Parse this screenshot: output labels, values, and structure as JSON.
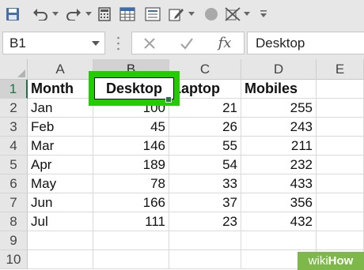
{
  "toolbar": {
    "icons": [
      "save-icon",
      "undo-icon",
      "redo-icon",
      "calculator-icon",
      "table-icon",
      "form-icon",
      "edit-icon",
      "circle-icon",
      "eraser-icon",
      "customize-icon"
    ]
  },
  "formula_bar": {
    "name_box": "B1",
    "function_label": "fx",
    "content": "Desktop"
  },
  "columns": [
    "A",
    "B",
    "C",
    "D",
    "E"
  ],
  "selected_column": "B",
  "rows": [
    "1",
    "2",
    "3",
    "4",
    "5",
    "6",
    "7",
    "8",
    "9",
    "10"
  ],
  "selected_row": "1",
  "headers": [
    "Month",
    "Desktop",
    "Laptop",
    "Mobiles"
  ],
  "data": [
    [
      "Jan",
      "100",
      "21",
      "255"
    ],
    [
      "Feb",
      "45",
      "26",
      "243"
    ],
    [
      "Mar",
      "146",
      "55",
      "211"
    ],
    [
      "Apr",
      "189",
      "54",
      "232"
    ],
    [
      "May",
      "78",
      "33",
      "433"
    ],
    [
      "Jun",
      "166",
      "37",
      "356"
    ],
    [
      "Jul",
      "111",
      "23",
      "432"
    ]
  ],
  "colors": {
    "highlight": "#22cc00",
    "excel_green": "#217346",
    "watermark": "#7fb84a"
  },
  "watermark": {
    "part1": "wiki",
    "part2": "How"
  }
}
